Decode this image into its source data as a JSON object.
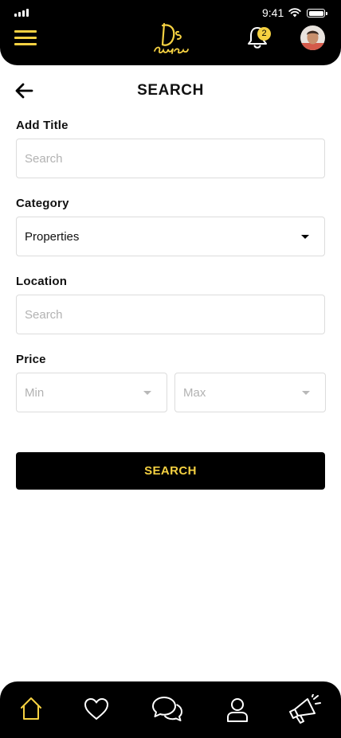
{
  "status_bar": {
    "time": "9:41"
  },
  "header": {
    "notification_count": "2",
    "colors": {
      "bar": "#000000",
      "accent": "#f5d142"
    }
  },
  "page": {
    "title": "SEARCH"
  },
  "form": {
    "add_title": {
      "label": "Add Title",
      "placeholder": "Search",
      "value": ""
    },
    "category": {
      "label": "Category",
      "value": "Properties"
    },
    "location": {
      "label": "Location",
      "placeholder": "Search",
      "value": ""
    },
    "price": {
      "label": "Price",
      "min_placeholder": "Min",
      "max_placeholder": "Max"
    },
    "submit_label": "SEARCH"
  },
  "bottom_nav": {
    "items": [
      {
        "icon": "home-icon",
        "active": true
      },
      {
        "icon": "heart-icon",
        "active": false
      },
      {
        "icon": "chat-icon",
        "active": false
      },
      {
        "icon": "user-icon",
        "active": false
      },
      {
        "icon": "megaphone-icon",
        "active": false
      }
    ]
  }
}
